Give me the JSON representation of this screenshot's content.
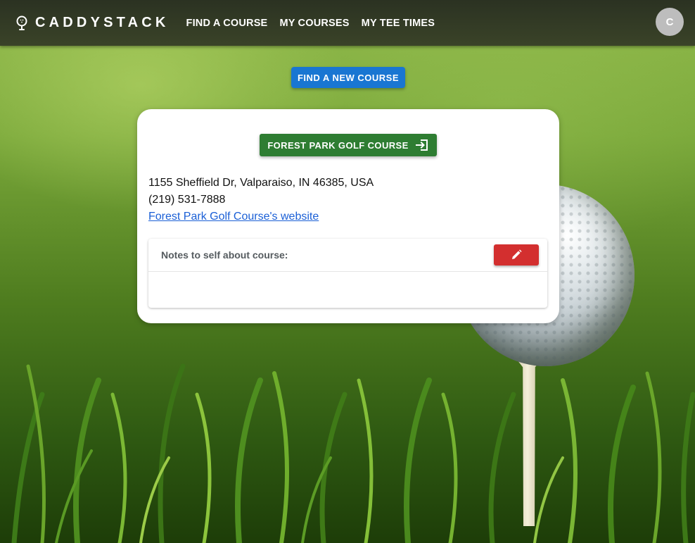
{
  "header": {
    "brand": "CADDYSTACK",
    "logo_icon": "golf-pin-icon",
    "nav": [
      "FIND A COURSE",
      "MY COURSES",
      "MY TEE TIMES"
    ],
    "avatar_initial": "C"
  },
  "main": {
    "find_new_course_label": "FIND A NEW COURSE",
    "course": {
      "name_button_label": "FOREST PARK GOLF COURSE",
      "name_button_icon": "enter-icon",
      "address": "1155 Sheffield Dr, Valparaiso, IN 46385, USA",
      "phone": "(219) 531-7888",
      "website_link": "Forest Park Golf Course's website"
    },
    "notes": {
      "title": "Notes to self about course:",
      "edit_icon": "pencil-icon",
      "content": ""
    }
  },
  "colors": {
    "header_bg": "#2b3222",
    "primary_blue": "#1976d2",
    "course_green": "#2e7d32",
    "edit_red": "#d32f2f",
    "link_blue": "#1a5fd6"
  }
}
